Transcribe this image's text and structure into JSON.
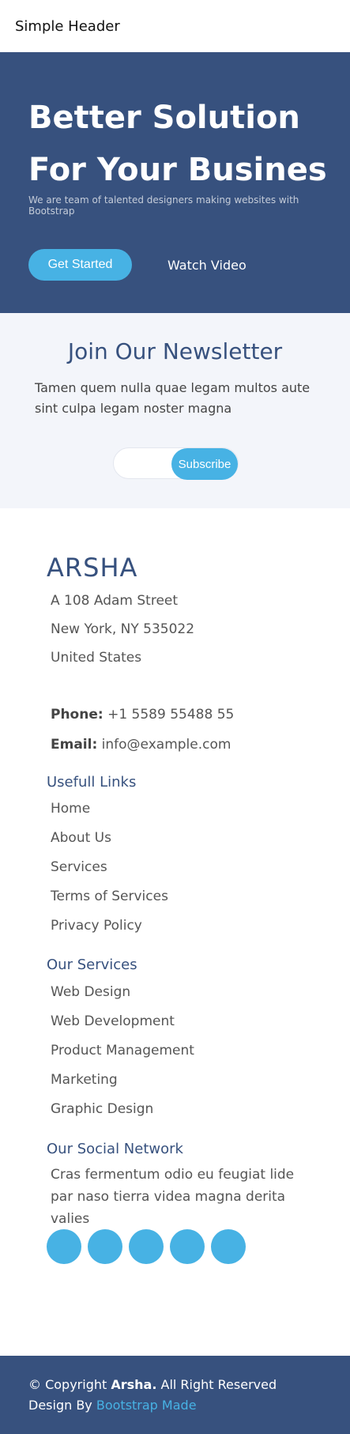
{
  "header": {
    "title": "Simple Header"
  },
  "hero": {
    "title": "Better Solution For Your Busines",
    "lead": "We are team of talented designers making websites with Bootstrap",
    "primary_button": "Get Started",
    "secondary_button": "Watch Video"
  },
  "newsletter": {
    "title": "Join Our Newsletter",
    "text": "Tamen quem nulla quae legam multos aute sint culpa legam noster magna",
    "input_placeholder": "",
    "button": "Subscribe"
  },
  "footer": {
    "brand": "ARSHA",
    "address": [
      "A 108 Adam Street",
      "New York, NY 535022",
      "United States"
    ],
    "phone_label": "Phone:",
    "phone_value": "+1 5589 55488 55",
    "email_label": "Email:",
    "email_value": "info@example.com",
    "useful_links_title": "Usefull Links",
    "useful_links": [
      "Home",
      "About Us",
      "Services",
      "Terms of Services",
      "Privacy Policy"
    ],
    "services_title": "Our Services",
    "services": [
      "Web Design",
      "Web Development",
      "Product Management",
      "Marketing",
      "Graphic Design"
    ],
    "social_title": "Our Social Network",
    "social_text": "Cras fermentum odio eu feugiat lide par naso tierra videa magna derita valies",
    "social_icons": [
      "social-1",
      "social-2",
      "social-3",
      "social-4",
      "social-5"
    ]
  },
  "bottom_bar": {
    "copyright_prefix": "© Copyright ",
    "copyright_brand": "Arsha.",
    "copyright_suffix": " All Right Reserved",
    "design_prefix": "Design By ",
    "design_link": "Bootstrap Made"
  },
  "colors": {
    "brand_blue": "#37517e",
    "accent": "#47b2e4",
    "light_bg": "#f3f5fa"
  }
}
